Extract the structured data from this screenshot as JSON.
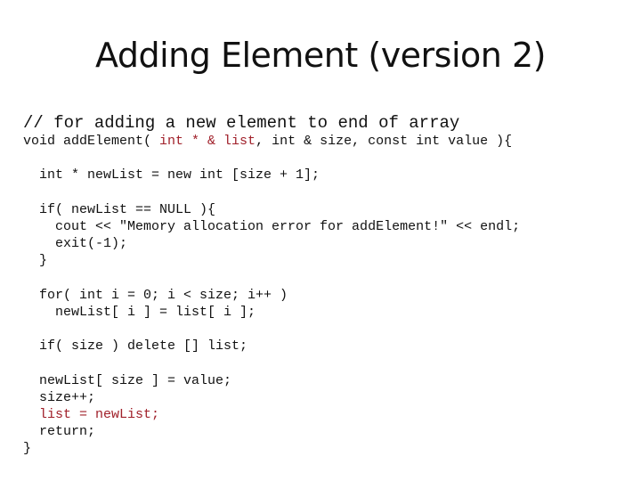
{
  "slide": {
    "title": "Adding Element (version 2)",
    "accent_color": "#a0202a",
    "code": {
      "comment": "// for adding a new element to end of array",
      "sig_a": "void addElement( ",
      "sig_red": "int * & list",
      "sig_b": ", int & size, const int value ){",
      "l_newlist": "  int * newList = new int [size + 1];",
      "l_if": "  if( newList == NULL ){",
      "l_cout": "    cout << \"Memory allocation error for addElement!\" << endl;",
      "l_exit": "    exit(-1);",
      "l_close1": "  }",
      "l_for": "  for( int i = 0; i < size; i++ )",
      "l_copy": "    newList[ i ] = list[ i ];",
      "l_delete": "  if( size ) delete [] list;",
      "l_assign": "  newList[ size ] = value;",
      "l_inc": "  size++;",
      "l_swap": "  list = newList;",
      "l_return": "  return;",
      "l_close2": "}"
    }
  }
}
